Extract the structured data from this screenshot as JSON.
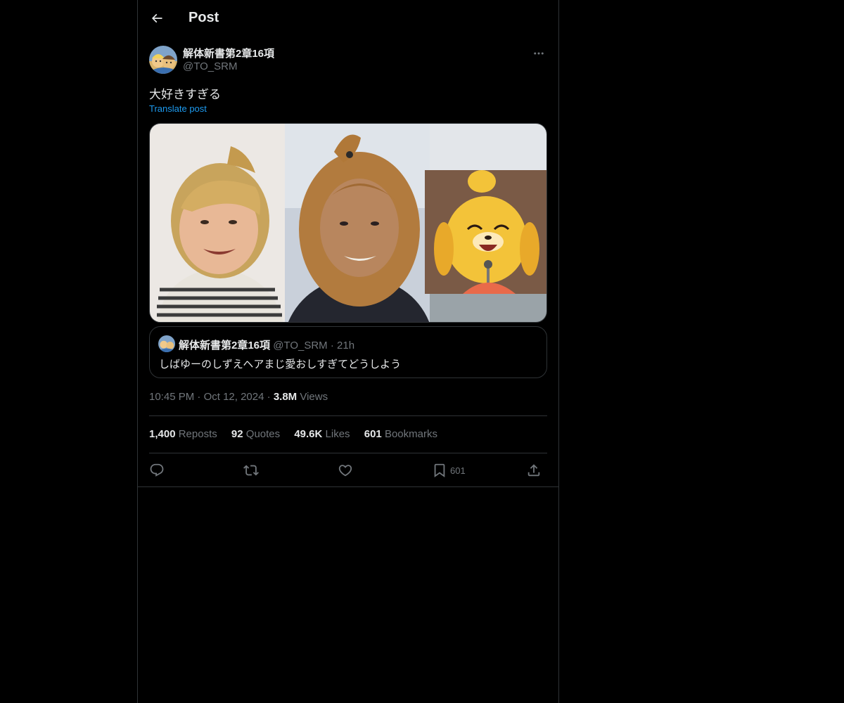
{
  "header": {
    "title": "Post",
    "back_icon": "arrow-left-icon"
  },
  "author": {
    "name": "解体新書第2章16項",
    "handle": "@TO_SRM",
    "avatar_icon": "avatar-image",
    "more_icon": "more-horizontal-icon"
  },
  "post": {
    "text": "大好きすぎる",
    "translate_label": "Translate post"
  },
  "quote": {
    "name": "解体新書第2章16項",
    "handle": "@TO_SRM",
    "separator": "·",
    "time": "21h",
    "text": "しばゆーのしずえヘアまじ愛おしすぎてどうしよう"
  },
  "meta": {
    "time": "10:45 PM",
    "separator": "·",
    "date": "Oct 12, 2024",
    "views_count": "3.8M",
    "views_label": "Views"
  },
  "stats": {
    "reposts_count": "1,400",
    "reposts_label": "Reposts",
    "quotes_count": "92",
    "quotes_label": "Quotes",
    "likes_count": "49.6K",
    "likes_label": "Likes",
    "bookmarks_count": "601",
    "bookmarks_label": "Bookmarks"
  },
  "actions": {
    "reply_icon": "reply-icon",
    "repost_icon": "repost-icon",
    "like_icon": "heart-icon",
    "bookmark_icon": "bookmark-icon",
    "bookmark_count": "601",
    "share_icon": "share-icon"
  },
  "colors": {
    "background": "#000000",
    "text": "#e7e9ea",
    "secondary": "#71767b",
    "link": "#1d9bf0",
    "border": "#2f3336"
  }
}
